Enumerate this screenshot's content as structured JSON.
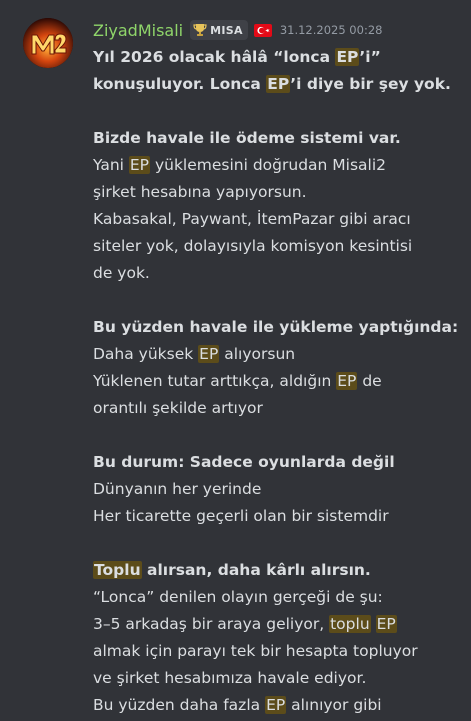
{
  "message": {
    "author": {
      "username": "ZiyadMisali",
      "avatar_text": "M2",
      "guild_tag": "MISA",
      "guild_tag_icon": "trophy-icon",
      "flag_icon": "turkey-flag-icon",
      "username_color": "#8fd56a"
    },
    "timestamp": "31.12.2025 00:28",
    "highlight_color": "#5c4c1a",
    "lines": [
      {
        "bold": true,
        "segments": [
          {
            "t": "Yıl 2026 olacak hâlâ “lonca "
          },
          {
            "t": "EP",
            "hl": true
          },
          {
            "t": "’i”"
          }
        ]
      },
      {
        "bold": true,
        "segments": [
          {
            "t": "konuşuluyor. Lonca "
          },
          {
            "t": "EP",
            "hl": true
          },
          {
            "t": "’i diye bir şey yok."
          }
        ]
      },
      {
        "blank": true
      },
      {
        "bold": true,
        "segments": [
          {
            "t": "Bizde havale ile ödeme sistemi var."
          }
        ]
      },
      {
        "segments": [
          {
            "t": "Yani "
          },
          {
            "t": "EP",
            "hl": true
          },
          {
            "t": " yüklemesini doğrudan Misali2"
          }
        ]
      },
      {
        "segments": [
          {
            "t": "şirket hesabına yapıyorsun."
          }
        ]
      },
      {
        "segments": [
          {
            "t": "Kabasakal, Paywant, İtemPazar gibi aracı"
          }
        ]
      },
      {
        "segments": [
          {
            "t": "siteler yok, dolayısıyla komisyon kesintisi"
          }
        ]
      },
      {
        "segments": [
          {
            "t": "de yok."
          }
        ]
      },
      {
        "blank": true
      },
      {
        "bold": true,
        "segments": [
          {
            "t": "Bu yüzden havale ile yükleme yaptığında:"
          }
        ]
      },
      {
        "segments": [
          {
            "t": "Daha yüksek "
          },
          {
            "t": "EP",
            "hl": true
          },
          {
            "t": " alıyorsun"
          }
        ]
      },
      {
        "segments": [
          {
            "t": "Yüklenen tutar arttıkça, aldığın "
          },
          {
            "t": "EP",
            "hl": true
          },
          {
            "t": " de"
          }
        ]
      },
      {
        "segments": [
          {
            "t": "orantılı şekilde artıyor"
          }
        ]
      },
      {
        "blank": true
      },
      {
        "bold": true,
        "segments": [
          {
            "t": "Bu durum: Sadece oyunlarda değil"
          }
        ]
      },
      {
        "segments": [
          {
            "t": "Dünyanın her yerinde"
          }
        ]
      },
      {
        "segments": [
          {
            "t": "Her ticarette geçerli olan bir sistemdir"
          }
        ]
      },
      {
        "blank": true
      },
      {
        "bold": true,
        "segments": [
          {
            "t": "Toplu",
            "hl": true
          },
          {
            "t": " alırsan, daha kârlı alırsın."
          }
        ]
      },
      {
        "segments": [
          {
            "t": "“Lonca” denilen olayın gerçeği de şu:"
          }
        ]
      },
      {
        "segments": [
          {
            "t": "3–5 arkadaş bir araya geliyor, "
          },
          {
            "t": "toplu",
            "hl": true
          },
          {
            "t": " "
          },
          {
            "t": "EP",
            "hl": true
          }
        ]
      },
      {
        "segments": [
          {
            "t": "almak için parayı tek bir hesapta topluyor"
          }
        ]
      },
      {
        "segments": [
          {
            "t": "ve şirket hesabımıza havale ediyor."
          }
        ]
      },
      {
        "segments": [
          {
            "t": "Bu yüzden daha fazla "
          },
          {
            "t": "EP",
            "hl": true
          },
          {
            "t": " alınıyor gibi"
          }
        ]
      }
    ]
  }
}
